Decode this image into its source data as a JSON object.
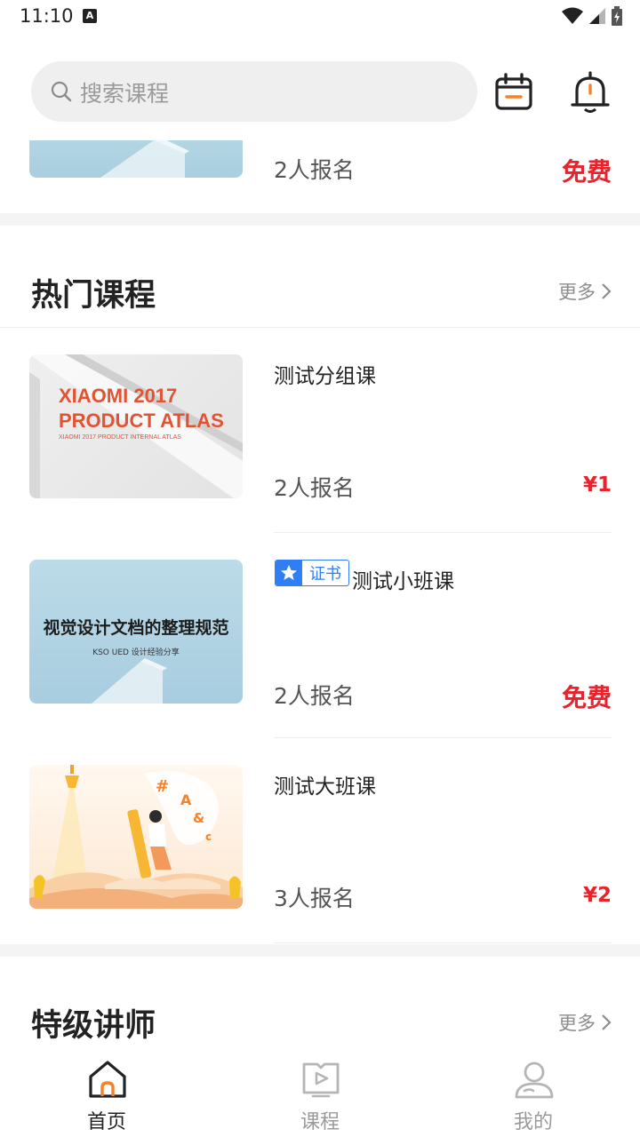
{
  "status_bar": {
    "time": "11:10",
    "notification_icon": "A"
  },
  "header": {
    "search_placeholder": "搜索课程"
  },
  "top_partial_card": {
    "enroll": "2人报名",
    "price": "免费"
  },
  "hot_courses": {
    "title": "热门课程",
    "more": "更多",
    "items": [
      {
        "title": "测试分组课",
        "enroll": "2人报名",
        "price": "¥1",
        "thumb_line1": "XIAOMI 2017",
        "thumb_line2": "PRODUCT ATLAS",
        "thumb_small": "XIAOMI 2017 PRODUCT INTERNAL ATLAS"
      },
      {
        "badge": "证书",
        "title": "测试小班课",
        "enroll": "2人报名",
        "price": "免费",
        "thumb_main": "视觉设计文档的整理规范",
        "thumb_sub": "KSO UED 设计经验分享"
      },
      {
        "title": "测试大班课",
        "enroll": "3人报名",
        "price": "¥2"
      }
    ]
  },
  "teachers": {
    "title": "特级讲师",
    "more": "更多"
  },
  "bottom_nav": {
    "items": [
      {
        "label": "首页",
        "icon": "home-icon",
        "active": true
      },
      {
        "label": "课程",
        "icon": "course-icon",
        "active": false
      },
      {
        "label": "我的",
        "icon": "profile-icon",
        "active": false
      }
    ]
  },
  "colors": {
    "price_red": "#e8232c",
    "accent_orange": "#f5822a",
    "cert_blue": "#2f7ef6",
    "muted_gray": "#9a9a9a"
  }
}
